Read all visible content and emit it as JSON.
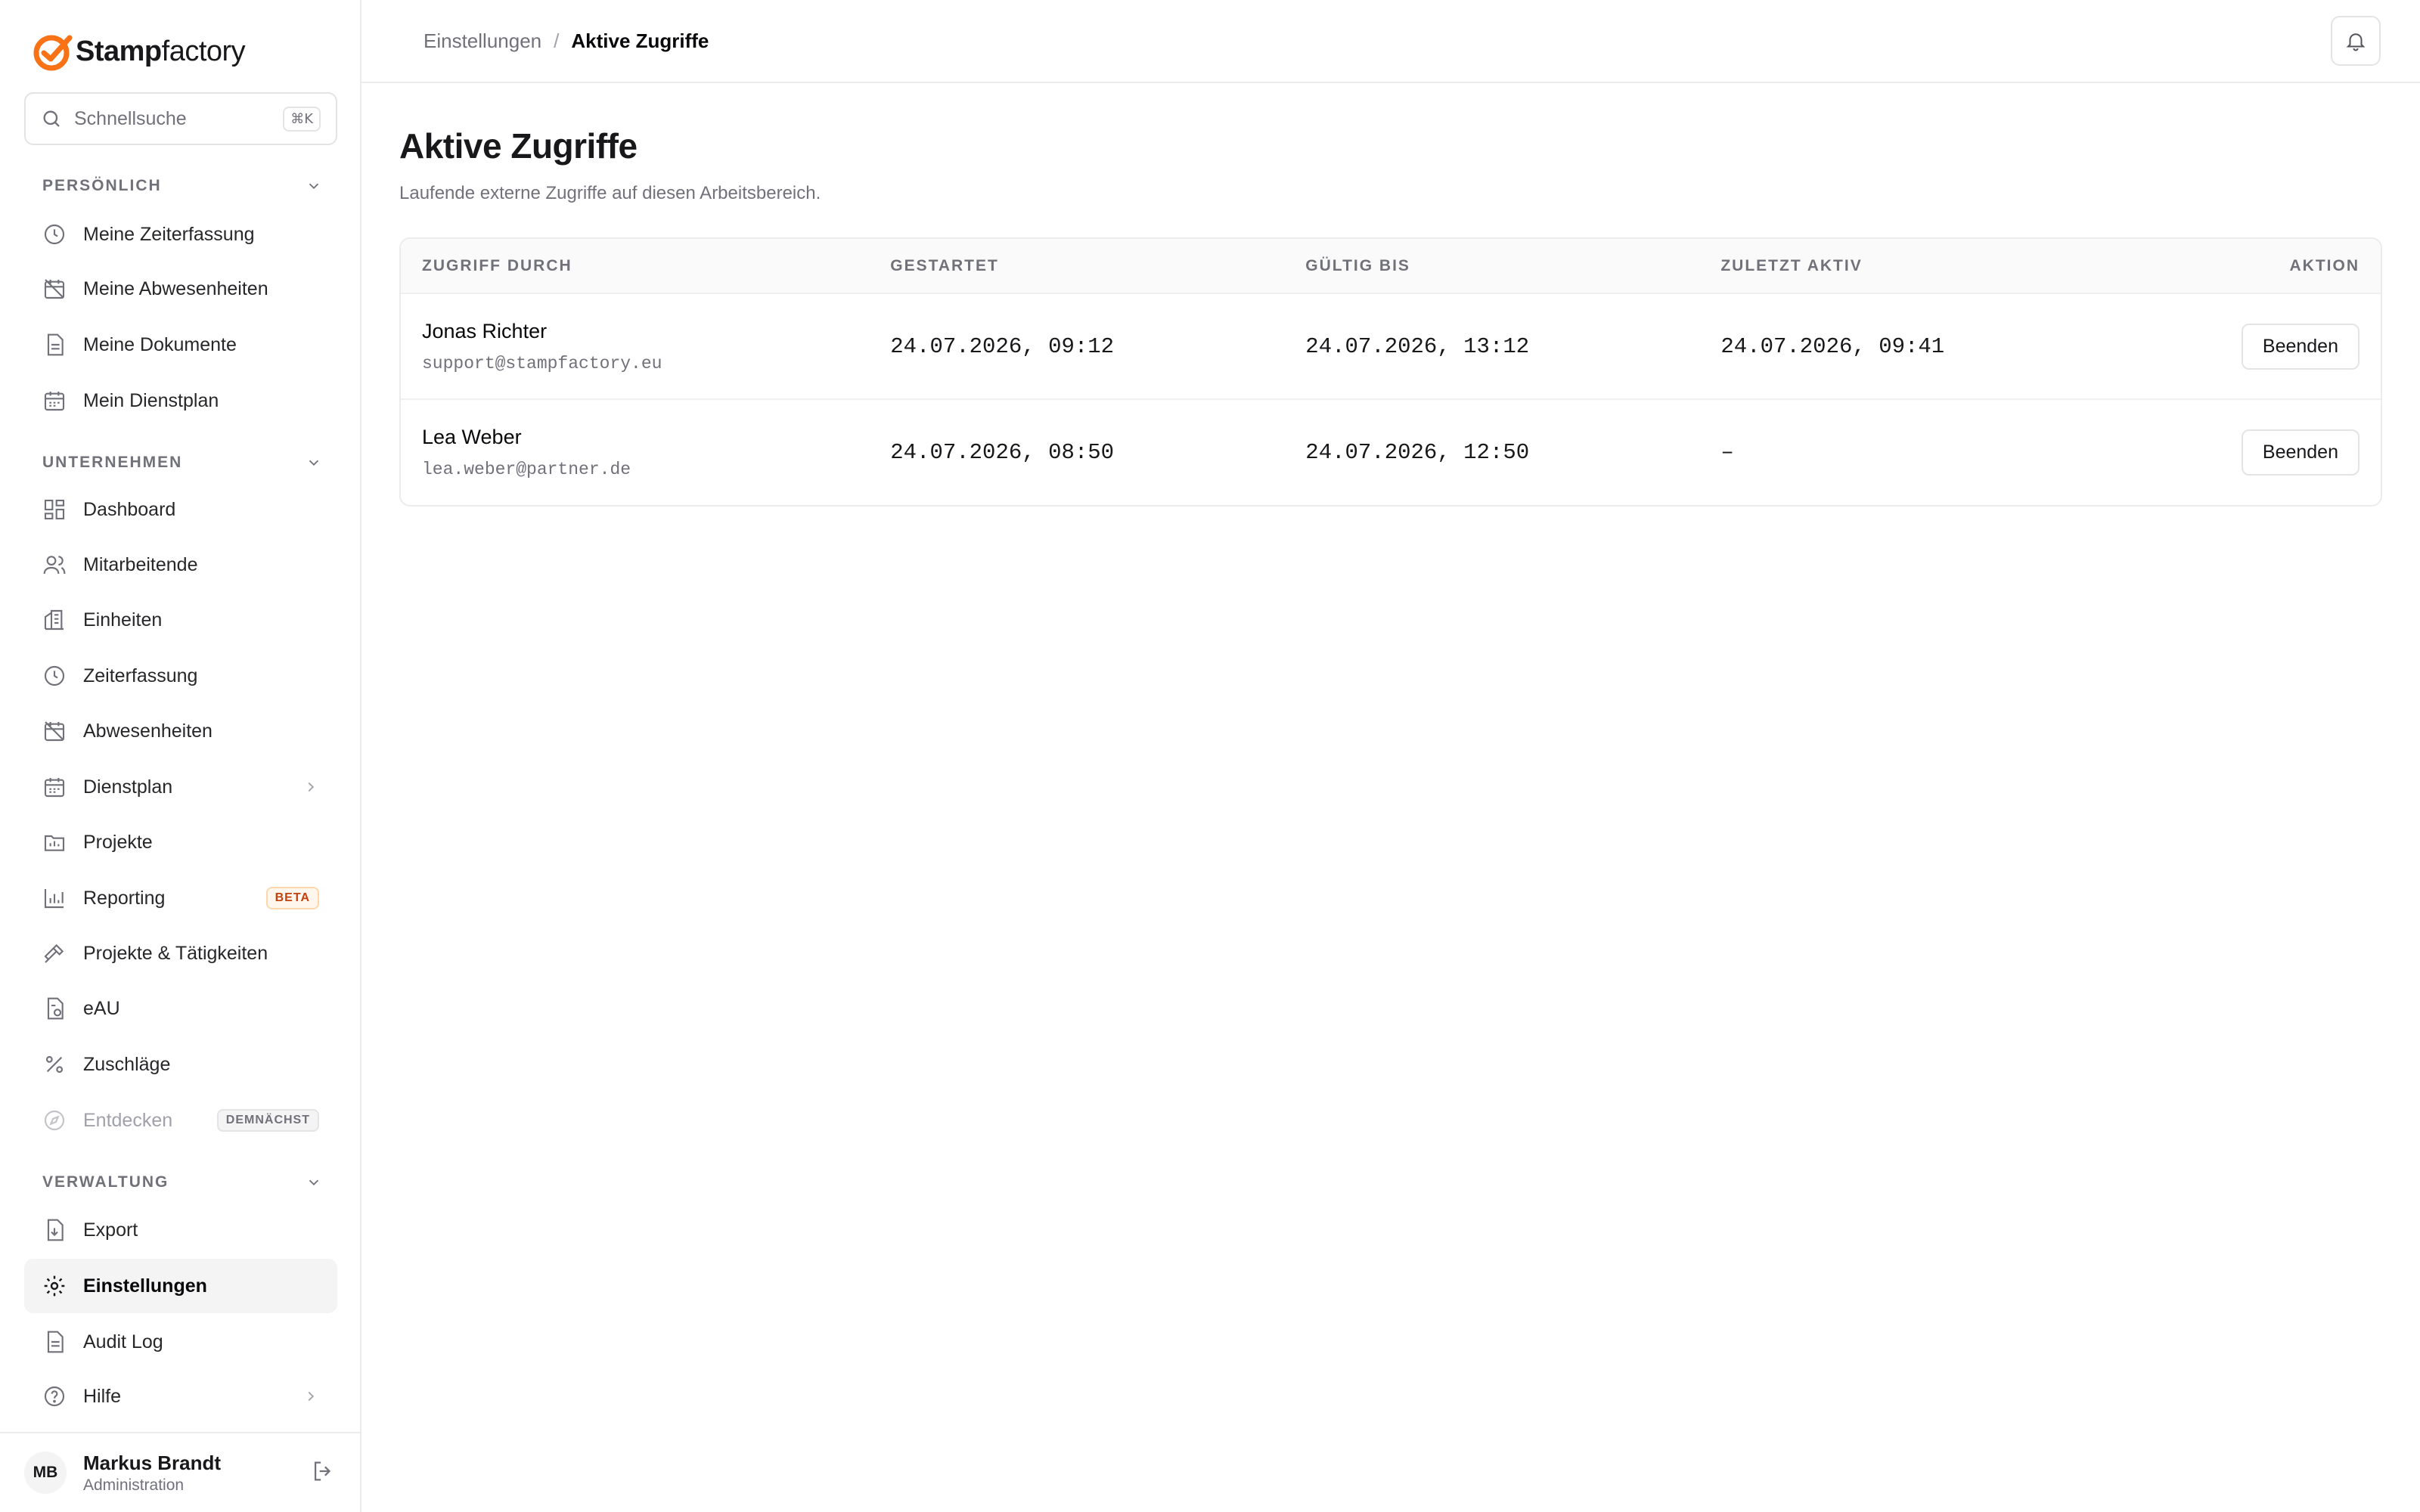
{
  "brand": {
    "name_bold": "Stamp",
    "name_light": "factory",
    "accent": "#f97316"
  },
  "search": {
    "placeholder": "Schnellsuche",
    "shortcut": "⌘K"
  },
  "sections": {
    "personal": "PERSÖNLICH",
    "company": "UNTERNEHMEN",
    "admin": "VERWALTUNG"
  },
  "nav": {
    "my_time": "Meine Zeiterfassung",
    "my_absences": "Meine Abwesenheiten",
    "my_documents": "Meine Dokumente",
    "my_schedule": "Mein Dienstplan",
    "dashboard": "Dashboard",
    "employees": "Mitarbeitende",
    "units": "Einheiten",
    "time_tracking": "Zeiterfassung",
    "absences": "Abwesenheiten",
    "schedule": "Dienstplan",
    "projects": "Projekte",
    "reporting": "Reporting",
    "reporting_badge": "BETA",
    "projects_activities": "Projekte & Tätigkeiten",
    "eau": "eAU",
    "surcharges": "Zuschläge",
    "discover": "Entdecken",
    "discover_badge": "DEMNÄCHST",
    "export": "Export",
    "settings": "Einstellungen",
    "audit_log": "Audit Log",
    "help": "Hilfe"
  },
  "user": {
    "initials": "MB",
    "name": "Markus Brandt",
    "role": "Administration"
  },
  "breadcrumb": {
    "parent": "Einstellungen",
    "separator": "/",
    "current": "Aktive Zugriffe"
  },
  "page": {
    "title": "Aktive Zugriffe",
    "subtitle": "Laufende externe Zugriffe auf diesen Arbeitsbereich."
  },
  "table": {
    "headers": [
      "ZUGRIFF DURCH",
      "GESTARTET",
      "GÜLTIG BIS",
      "ZULETZT AKTIV",
      "AKTION"
    ],
    "rows": [
      {
        "name": "Jonas Richter",
        "email": "support@stampfactory.eu",
        "started": "24.07.2026, 09:12",
        "valid_until": "24.07.2026, 13:12",
        "last_active": "24.07.2026, 09:41",
        "action": "Beenden"
      },
      {
        "name": "Lea Weber",
        "email": "lea.weber@partner.de",
        "started": "24.07.2026, 08:50",
        "valid_until": "24.07.2026, 12:50",
        "last_active": "–",
        "action": "Beenden"
      }
    ]
  }
}
